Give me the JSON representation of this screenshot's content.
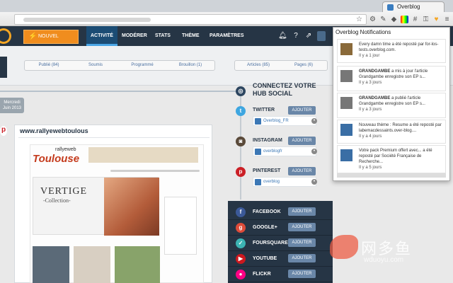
{
  "browser": {
    "tab_title": "Overblog"
  },
  "app_nav": {
    "new_article": "NOUVEL ARTICLE",
    "items": [
      "ACTIVITÉ",
      "MODÉRER",
      "STATS",
      "THÈME",
      "PARAMÈTRES"
    ],
    "active_index": 0
  },
  "filters": {
    "status_tabs": [
      "Publié (84)",
      "Soumis",
      "Programmé",
      "Brouillon (1)"
    ],
    "type_tabs": [
      "Articles (85)",
      "Pages (6)"
    ]
  },
  "timeline": {
    "date_line1": "Mercredi",
    "date_line2": "Juin 2013"
  },
  "post": {
    "title": "www.rallyewebtoulous",
    "site_logo": "Toulouse",
    "site_logo_small": "rallyeweb",
    "hero_title": "VERTIGE",
    "hero_subtitle": "-Collection-"
  },
  "hub": {
    "title": "CONNECTEZ VOTRE HUB SOCIAL",
    "add_label": "AJOUTER",
    "networks": [
      {
        "name": "TWITTER",
        "account": "Overblog_FR"
      },
      {
        "name": "INSTAGRAM",
        "account": "overblogfr"
      },
      {
        "name": "PINTEREST",
        "account": "overblog"
      }
    ],
    "more": [
      "FACEBOOK",
      "GOOGLE+",
      "FOURSQUARE",
      "YOUTUBE",
      "FLICKR"
    ]
  },
  "notifications": {
    "title": "Overblog Notifications",
    "items": [
      {
        "who": "",
        "text": "Every damn time a été reposté par for-los-tests.overblog.com.",
        "time": "Il y a 1 jour"
      },
      {
        "who": "GRANDGAMBE",
        "text": " a mis à jour l'article Grandgambe enregistre son EP s...",
        "time": "Il y a 3 jours"
      },
      {
        "who": "GRANDGAMBE",
        "text": " a publié l'article Grandgambe enregistre son EP s...",
        "time": "Il y a 3 jours"
      },
      {
        "who": "",
        "text": "Nouveau thème : Resume a été reposté par labemacdessaints.over-blog....",
        "time": "Il y a 4 jours"
      },
      {
        "who": "",
        "text": "Votre pack Premium offert avec... a été reposté par Société Française de Recherche...",
        "time": "Il y a 5 jours"
      }
    ]
  },
  "watermark": {
    "cn": "网多鱼",
    "en": "wduoyu.com"
  }
}
